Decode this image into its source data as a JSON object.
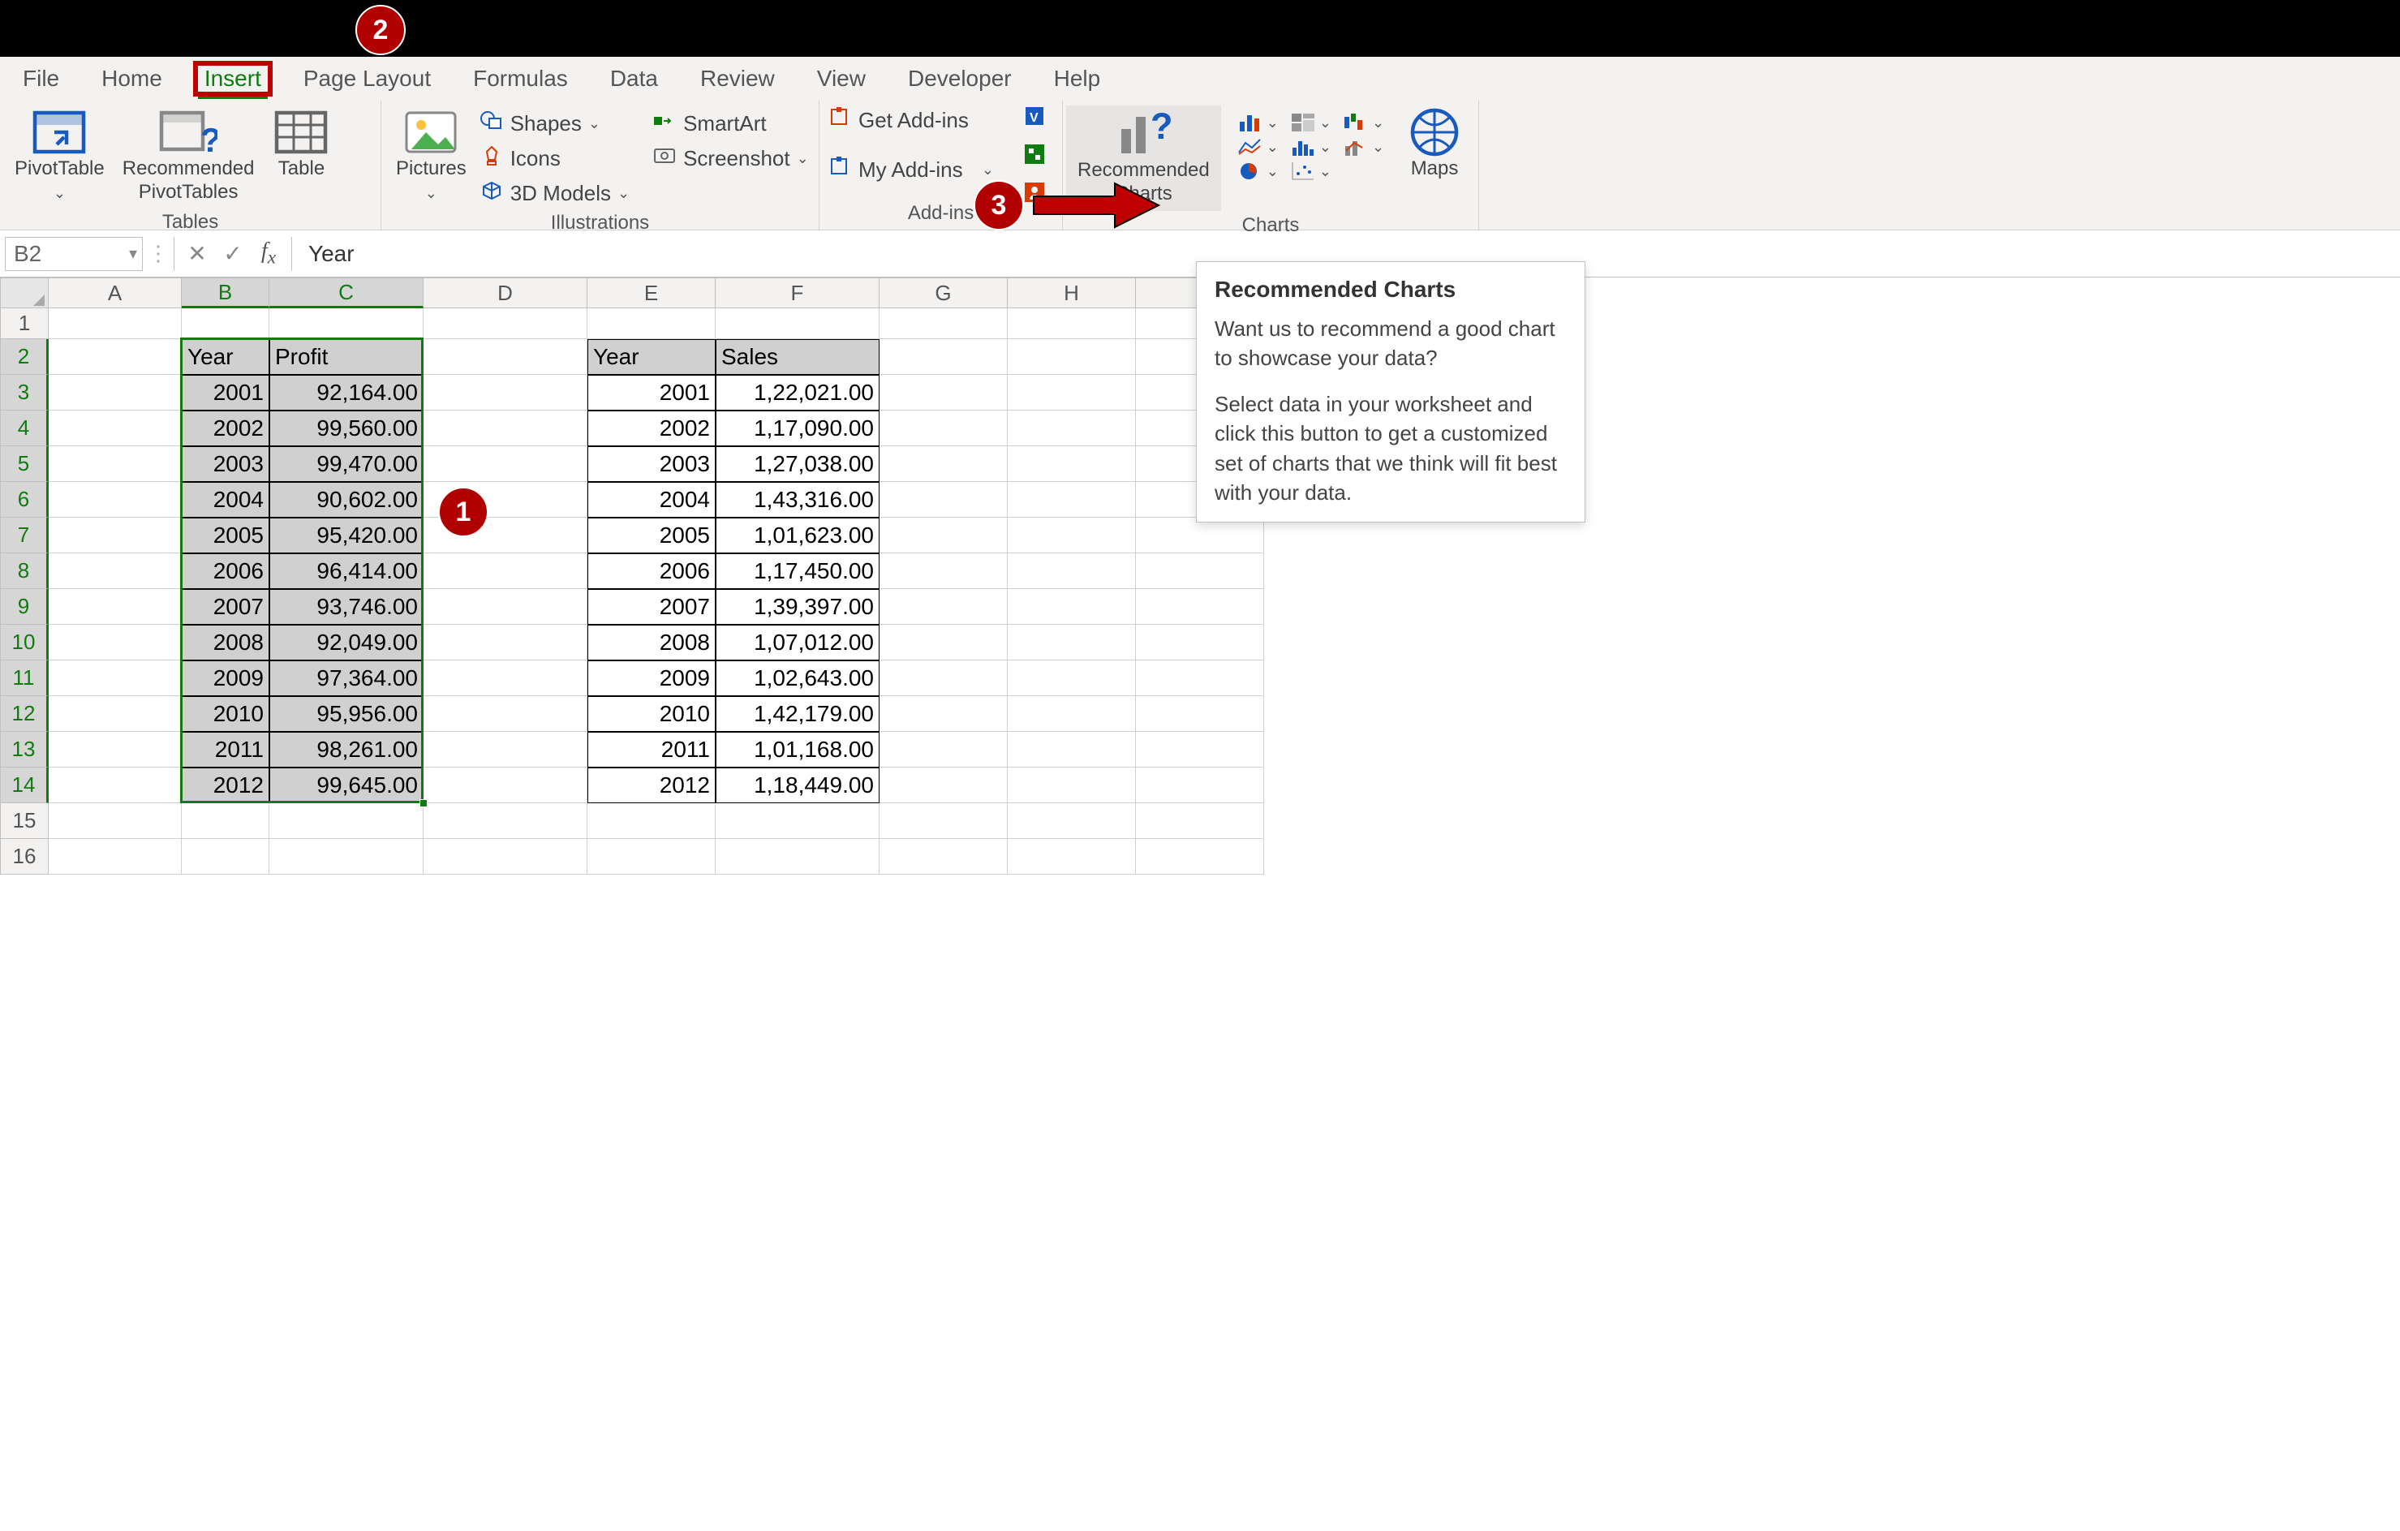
{
  "tabs": {
    "file": "File",
    "home": "Home",
    "insert": "Insert",
    "pagelayout": "Page Layout",
    "formulas": "Formulas",
    "data": "Data",
    "review": "Review",
    "view": "View",
    "developer": "Developer",
    "help": "Help"
  },
  "ribbon": {
    "tables": {
      "pivottable": "PivotTable",
      "rec_pivot": "Recommended\nPivotTables",
      "table": "Table",
      "label": "Tables"
    },
    "illustrations": {
      "pictures": "Pictures",
      "shapes": "Shapes",
      "icons": "Icons",
      "models": "3D Models",
      "smartart": "SmartArt",
      "screenshot": "Screenshot",
      "label": "Illustrations"
    },
    "addins": {
      "get": "Get Add-ins",
      "my": "My Add-ins",
      "label": "Add-ins"
    },
    "charts": {
      "recommended": "Recommended\nCharts",
      "maps": "Maps",
      "label": "Charts"
    }
  },
  "formula_bar": {
    "namebox": "B2",
    "value": "Year"
  },
  "columns": [
    "A",
    "B",
    "C",
    "D",
    "E",
    "F",
    "G",
    "H",
    "I"
  ],
  "rows": [
    "1",
    "2",
    "3",
    "4",
    "5",
    "6",
    "7",
    "8",
    "9",
    "10",
    "11",
    "12",
    "13",
    "14",
    "15",
    "16"
  ],
  "table1": {
    "headers": {
      "year": "Year",
      "profit": "Profit"
    },
    "data": [
      {
        "year": "2001",
        "profit": "92,164.00"
      },
      {
        "year": "2002",
        "profit": "99,560.00"
      },
      {
        "year": "2003",
        "profit": "99,470.00"
      },
      {
        "year": "2004",
        "profit": "90,602.00"
      },
      {
        "year": "2005",
        "profit": "95,420.00"
      },
      {
        "year": "2006",
        "profit": "96,414.00"
      },
      {
        "year": "2007",
        "profit": "93,746.00"
      },
      {
        "year": "2008",
        "profit": "92,049.00"
      },
      {
        "year": "2009",
        "profit": "97,364.00"
      },
      {
        "year": "2010",
        "profit": "95,956.00"
      },
      {
        "year": "2011",
        "profit": "98,261.00"
      },
      {
        "year": "2012",
        "profit": "99,645.00"
      }
    ]
  },
  "table2": {
    "headers": {
      "year": "Year",
      "sales": "Sales"
    },
    "data": [
      {
        "year": "2001",
        "sales": "1,22,021.00"
      },
      {
        "year": "2002",
        "sales": "1,17,090.00"
      },
      {
        "year": "2003",
        "sales": "1,27,038.00"
      },
      {
        "year": "2004",
        "sales": "1,43,316.00"
      },
      {
        "year": "2005",
        "sales": "1,01,623.00"
      },
      {
        "year": "2006",
        "sales": "1,17,450.00"
      },
      {
        "year": "2007",
        "sales": "1,39,397.00"
      },
      {
        "year": "2008",
        "sales": "1,07,012.00"
      },
      {
        "year": "2009",
        "sales": "1,02,643.00"
      },
      {
        "year": "2010",
        "sales": "1,42,179.00"
      },
      {
        "year": "2011",
        "sales": "1,01,168.00"
      },
      {
        "year": "2012",
        "sales": "1,18,449.00"
      }
    ]
  },
  "tooltip": {
    "title": "Recommended Charts",
    "p1": "Want us to recommend a good chart to showcase your data?",
    "p2": "Select data in your worksheet and click this button to get a customized set of charts that we think will fit best with your data."
  },
  "callouts": {
    "c1": "1",
    "c2": "2",
    "c3": "3"
  }
}
